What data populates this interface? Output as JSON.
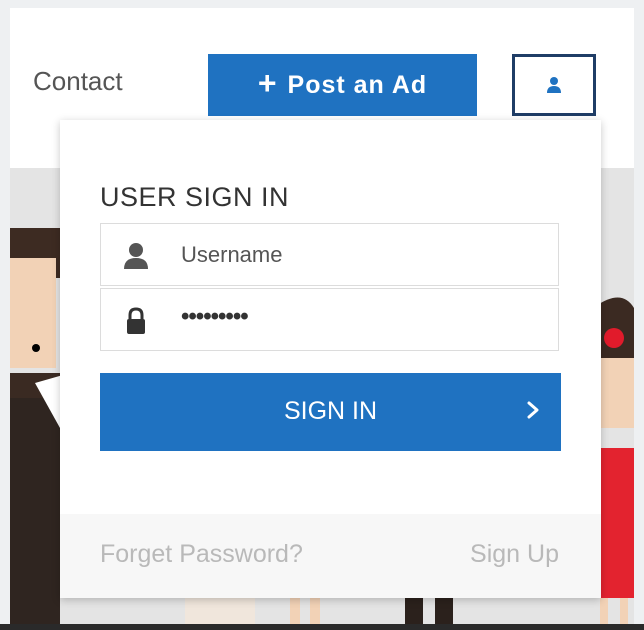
{
  "nav": {
    "contact_label": "Contact",
    "post_ad_label": "Post an Ad",
    "post_ad_icon": "plus-icon",
    "user_icon": "user-icon"
  },
  "signin": {
    "title": "USER SIGN IN",
    "username_value": "Username",
    "password_value": "•••••••••",
    "username_icon": "user-icon",
    "password_icon": "lock-icon",
    "submit_label": "SIGN IN",
    "submit_icon": "chevron-right-icon",
    "forget_label": "Forget Password?",
    "signup_label": "Sign Up"
  },
  "colors": {
    "accent": "#1f72c1",
    "muted_text": "#b9b9b9",
    "border": "#1f3d66"
  }
}
